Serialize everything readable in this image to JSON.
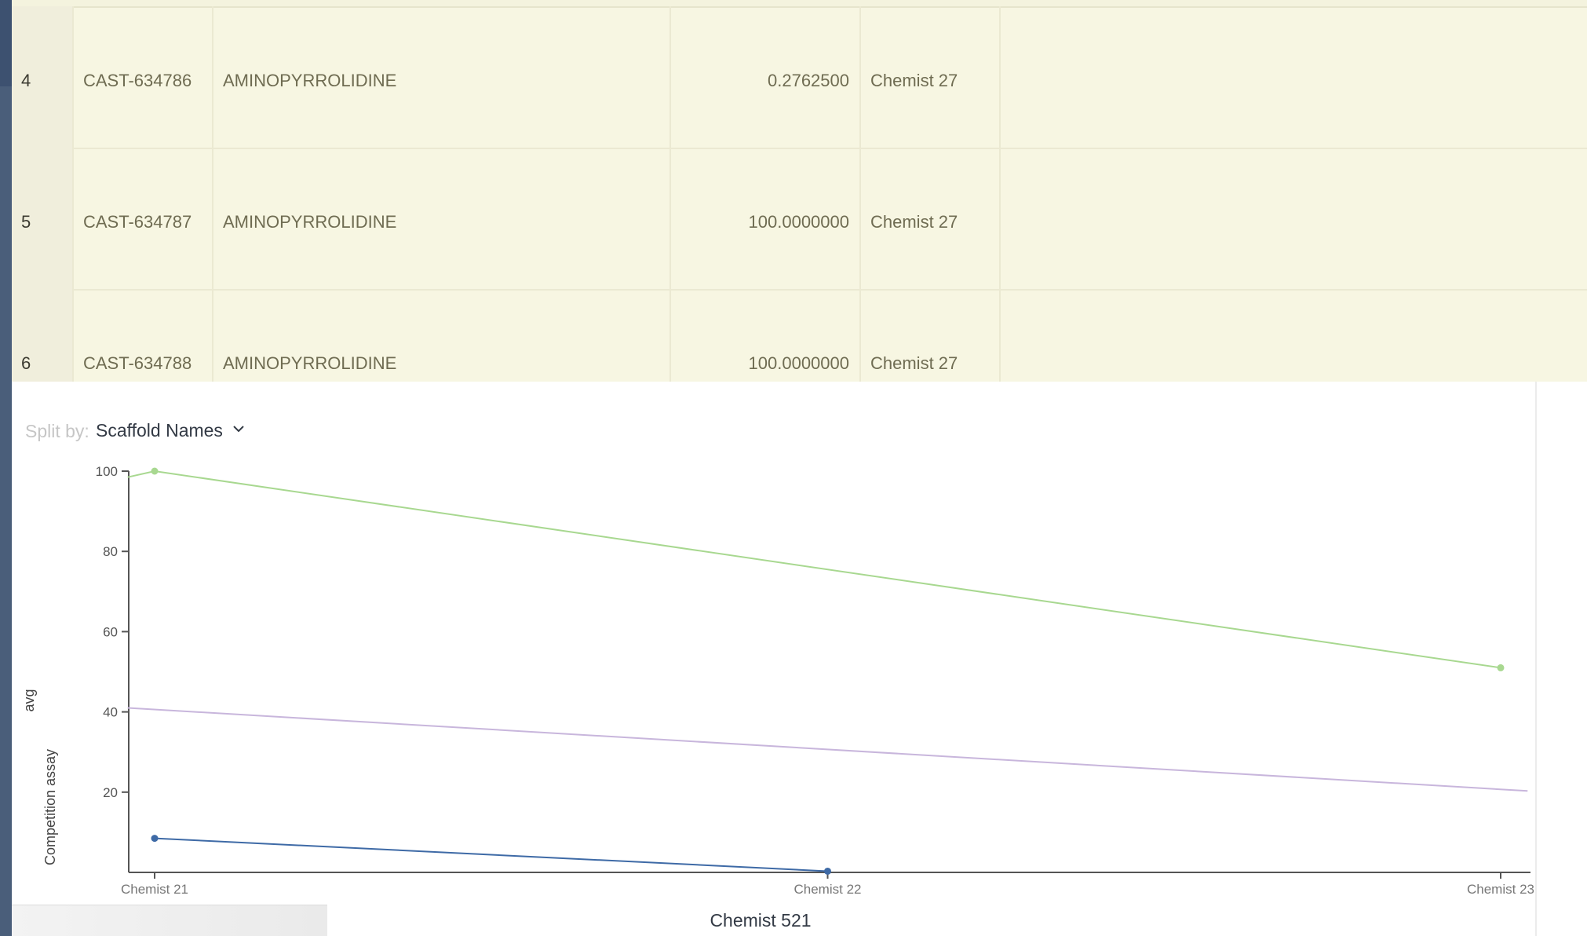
{
  "table": {
    "rows": [
      {
        "index": "4",
        "id": "CAST-634786",
        "scaffold": "AMINOPYRROLIDINE",
        "value": "0.2762500",
        "chemist": "Chemist 27"
      },
      {
        "index": "5",
        "id": "CAST-634787",
        "scaffold": "AMINOPYRROLIDINE",
        "value": "100.0000000",
        "chemist": "Chemist 27"
      },
      {
        "index": "6",
        "id": "CAST-634788",
        "scaffold": "AMINOPYRROLIDINE",
        "value": "100.0000000",
        "chemist": "Chemist 27"
      }
    ]
  },
  "chart_controls": {
    "split_label": "Split by:",
    "split_value": "Scaffold Names",
    "chevron_icon": "chevron-down-icon"
  },
  "chart_data": {
    "type": "line",
    "xlabel": "Chemist 521",
    "ylabel_lines": [
      "Competition assay",
      "avg"
    ],
    "categories": [
      "Chemist 21",
      "Chemist 22",
      "Chemist 23"
    ],
    "yticks": [
      20,
      40,
      60,
      80,
      100
    ],
    "ylim": [
      0,
      100
    ],
    "series": [
      {
        "color": "#a8d890",
        "points": [
          [
            -0.04,
            98.5
          ],
          [
            0,
            100
          ],
          [
            2,
            51
          ]
        ],
        "markers": [
          1,
          2
        ]
      },
      {
        "color": "#c8b6dc",
        "points": [
          [
            -0.04,
            41
          ],
          [
            2.04,
            20.3
          ]
        ],
        "markers": []
      },
      {
        "color": "#3e6aa6",
        "points": [
          [
            0,
            8.5
          ],
          [
            1,
            0.3
          ]
        ],
        "markers": [
          0,
          1
        ]
      }
    ]
  }
}
